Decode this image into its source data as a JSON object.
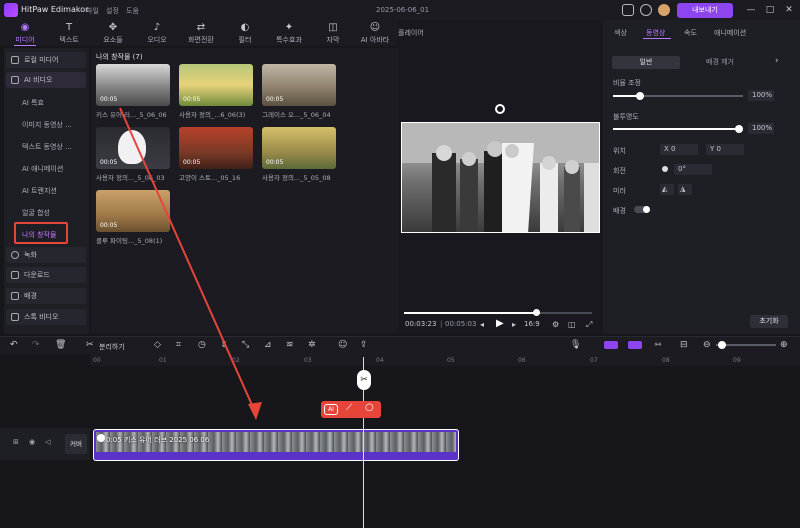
{
  "app": {
    "name": "HitPaw Edimakor",
    "menu": [
      "파일",
      "설정",
      "도움"
    ],
    "doc_title": "2025-06-06_01",
    "export_label": "내보내기"
  },
  "tools": [
    {
      "label": "미디어",
      "icon": "media-icon",
      "active": true
    },
    {
      "label": "텍스트",
      "icon": "text-icon"
    },
    {
      "label": "요소들",
      "icon": "elements-icon"
    },
    {
      "label": "오디오",
      "icon": "audio-icon"
    },
    {
      "label": "화면전환",
      "icon": "transition-icon"
    },
    {
      "label": "필터",
      "icon": "filter-icon"
    },
    {
      "label": "특수효과",
      "icon": "effects-icon"
    },
    {
      "label": "자막",
      "icon": "subtitle-icon"
    },
    {
      "label": "AI 아바타",
      "icon": "avatar-icon"
    }
  ],
  "sidebar": {
    "local_media": "로컬 미디어",
    "ai_video": "AI 비디오",
    "ai_subitems": [
      "AI 특효",
      "이미지 동영상 ...",
      "텍스트 동영상 ...",
      "AI 애니메이션",
      "AI 트랜지션",
      "얼굴 합성",
      "나의 창작물"
    ],
    "record": "녹화",
    "download": "다운로드",
    "background": "배경",
    "stock_video": "스톡 비디오"
  },
  "media": {
    "title": "나의 창작물 (7)",
    "items": [
      {
        "label": "키스 유어 러..._5_06_06",
        "duration": "00:05"
      },
      {
        "label": "사용자 정의_...6_06(3)",
        "duration": "00:05"
      },
      {
        "label": "그레이스 오..._5_06_04",
        "duration": "00:05"
      },
      {
        "label": "사용자 정의..._5_06_03",
        "duration": "00:05"
      },
      {
        "label": "고양이 스토..._05_16",
        "duration": "00:05"
      },
      {
        "label": "사용자 정의..._5_05_08",
        "duration": "00:05"
      },
      {
        "label": "클루 파이팅..._5_08(1)",
        "duration": "00:05"
      }
    ]
  },
  "player": {
    "title": "플레이어",
    "current_time": "00:03:23",
    "total_time": "00:05:03",
    "progress": 0.7,
    "aspect": "16:9"
  },
  "props": {
    "tabs": [
      "색상",
      "동영상",
      "속도",
      "애니메이션"
    ],
    "active_tab": "동영상",
    "subtabs": [
      "일반",
      "배경 제거"
    ],
    "scale_label": "비율 조정",
    "scale_value": "100%",
    "opacity_label": "불투명도",
    "opacity_value": "100%",
    "position_label": "위치",
    "x_label": "X",
    "x_value": "0",
    "y_label": "Y",
    "y_value": "0",
    "rotate_label": "회전",
    "rotate_value": "0°",
    "mirror_label": "미러",
    "background_label": "배경",
    "reset_label": "초기화"
  },
  "timeline": {
    "split_label": "분리하기",
    "ruler": [
      "00",
      "01",
      "02",
      "03",
      "04",
      "05",
      "06",
      "07",
      "08",
      "09"
    ],
    "track_label": "커버",
    "clip_label": "0:05 키스 유어 러브 2025 06 06"
  }
}
